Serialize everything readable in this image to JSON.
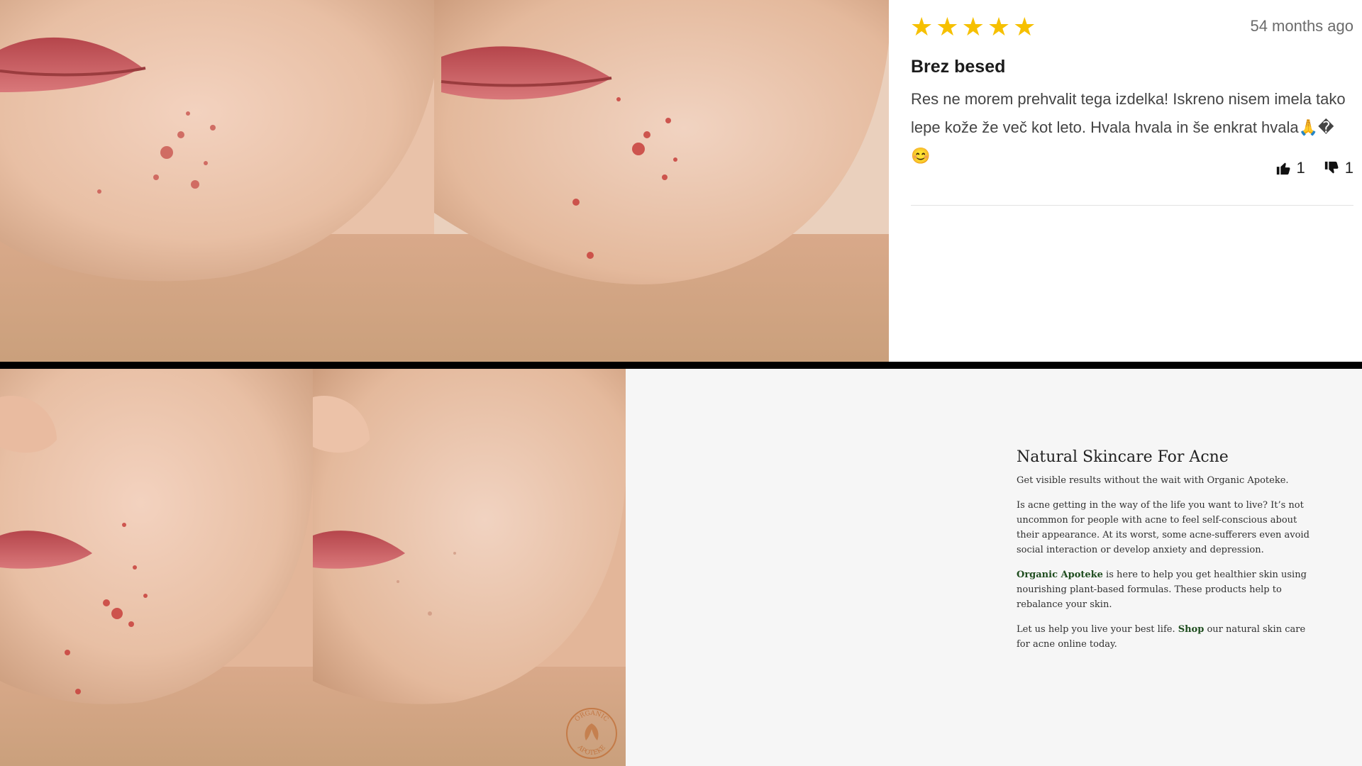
{
  "review": {
    "rating": 5,
    "stars": [
      "★",
      "★",
      "★",
      "★",
      "★"
    ],
    "date": "54 months ago",
    "title": "Brez besed",
    "body": "Res ne morem prehvalit tega izdelka! Iskreno nisem imela tako lepe kože že več kot leto. Hvala hvala in še enkrat hvala🙏�😊",
    "upvotes": "1",
    "downvotes": "1"
  },
  "article": {
    "title": "Natural Skincare For Acne",
    "intro": "Get visible results without the wait with Organic Apoteke.",
    "paragraph2": "Is acne getting in the way of the life you want to live? It’s not uncommon for people with acne to feel self-conscious about their appearance. At its worst, some acne-sufferers even avoid social interaction or develop anxiety and depression.",
    "brand_link": "Organic Apoteke",
    "paragraph3_rest": " is here to help you get healthier skin using nourishing plant-based formulas. These products help to rebalance your skin.",
    "paragraph4_start": "Let us help you live your best life. ",
    "shop_link": "Shop",
    "paragraph4_end": " our natural skin care for acne online today."
  },
  "watermark": {
    "text_top": "ORGANIC",
    "text_bottom": "APOTEKE"
  },
  "colors": {
    "star": "#f6c000",
    "link_green": "#1f4d1f",
    "panel_bg": "#f6f6f6",
    "watermark": "#c0703a"
  }
}
